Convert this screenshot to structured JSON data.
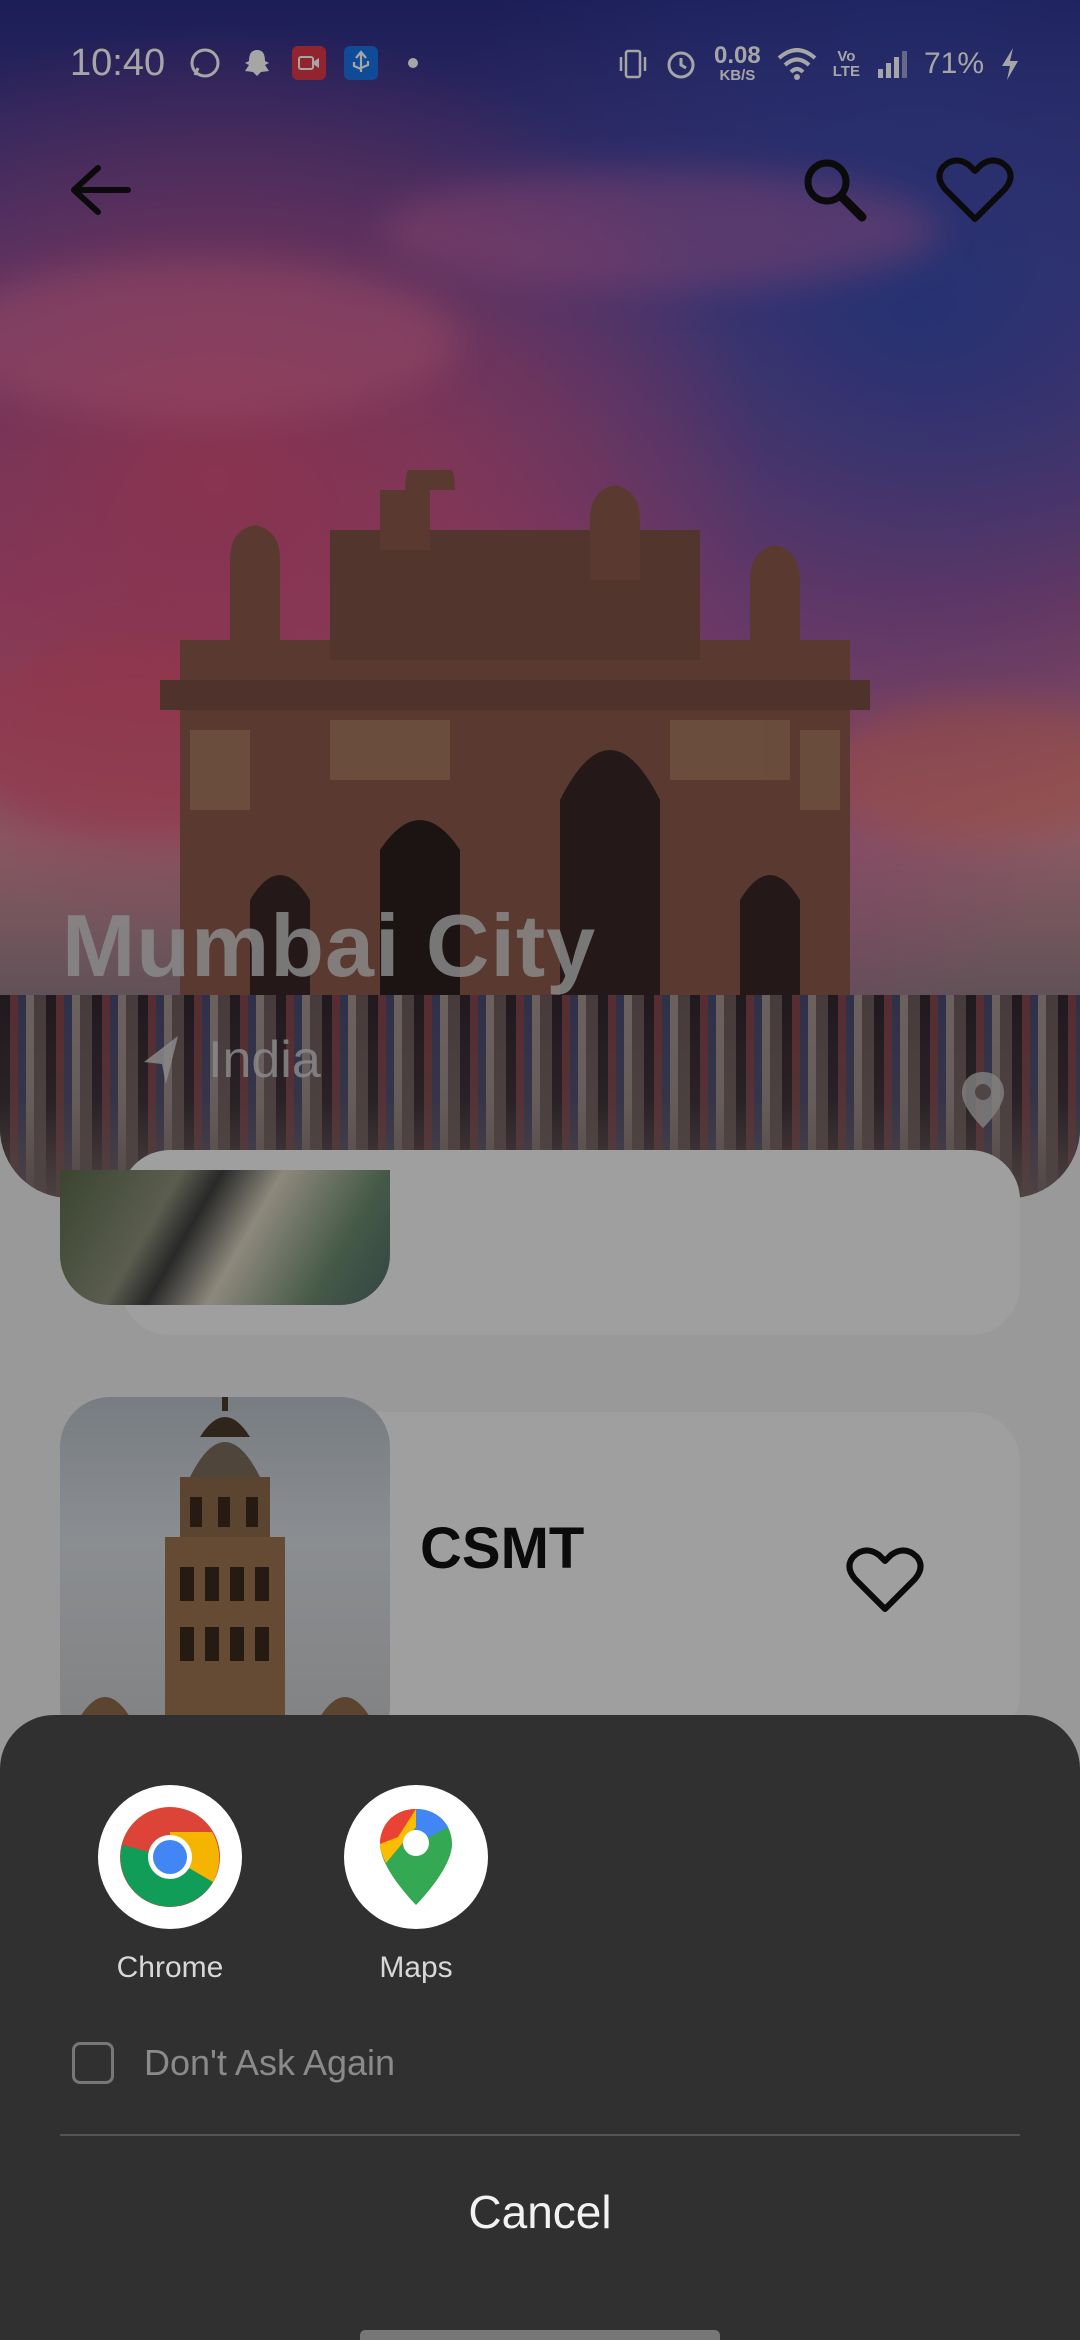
{
  "status_bar": {
    "time": "10:40",
    "network_speed": "0.08",
    "network_speed_unit": "KB/S",
    "battery": "71%",
    "icons_left": [
      "whatsapp-icon",
      "snapchat-icon",
      "screen-recorder-icon",
      "usb-icon",
      "dot-icon"
    ],
    "icons_right": [
      "vibrate-icon",
      "alarm-icon",
      "wifi-icon",
      "volte-icon",
      "signal-icon",
      "charging-icon"
    ]
  },
  "hero": {
    "city": "Mumbai City",
    "country": "India"
  },
  "list": {
    "items": [
      {
        "title": ""
      },
      {
        "title": "CSMT"
      }
    ]
  },
  "chooser": {
    "apps": [
      {
        "label": "Chrome",
        "icon": "chrome-icon"
      },
      {
        "label": "Maps",
        "icon": "google-maps-icon"
      }
    ],
    "dont_ask_label": "Don't Ask Again",
    "dont_ask_checked": false,
    "cancel_label": "Cancel"
  },
  "colors": {
    "sheet_bg": "#303030",
    "scrim": "rgba(0,0,0,0.35)"
  }
}
